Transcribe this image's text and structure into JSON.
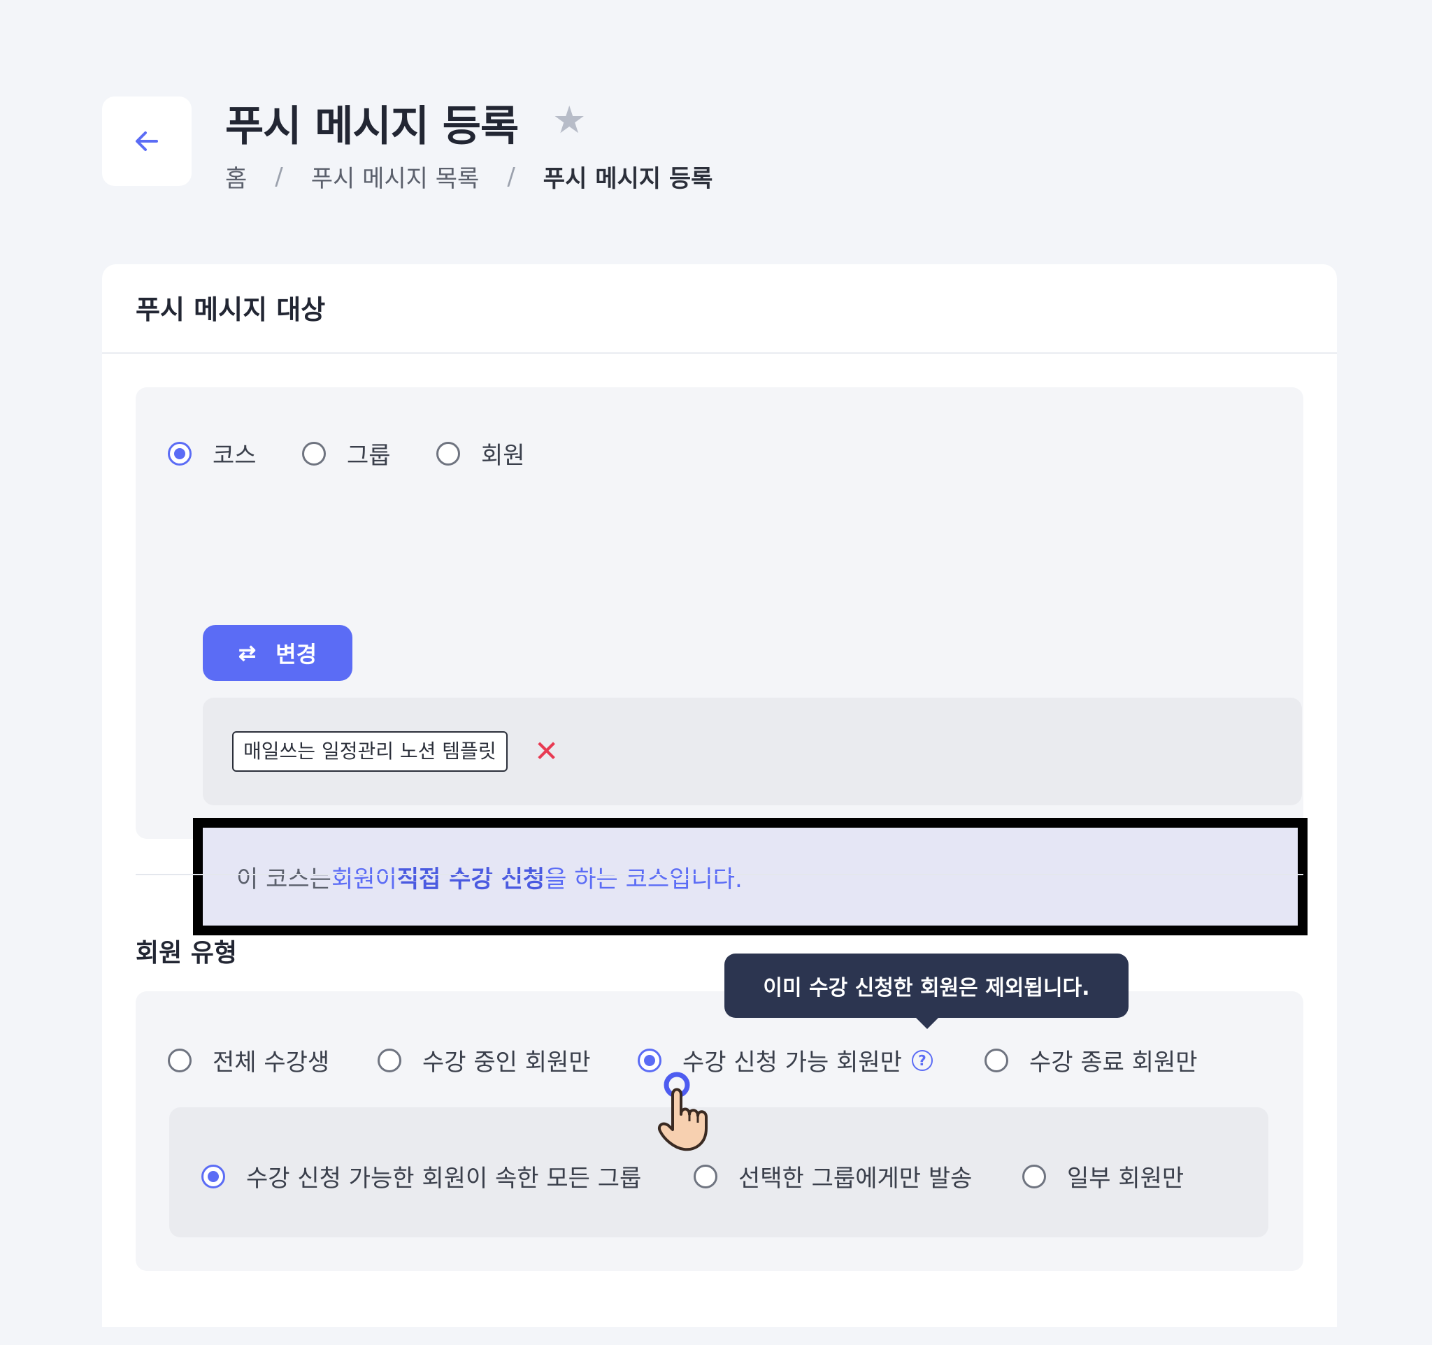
{
  "header": {
    "back_icon": "arrow-left-icon",
    "title": "푸시 메시지 등록",
    "star_icon": "star-icon",
    "breadcrumb": [
      "홈",
      "푸시 메시지 목록",
      "푸시 메시지 등록"
    ],
    "breadcrumb_sep": "/"
  },
  "card": {
    "title": "푸시 메시지 대상",
    "target_options": [
      {
        "label": "코스",
        "selected": true
      },
      {
        "label": "그룹",
        "selected": false
      },
      {
        "label": "회원",
        "selected": false
      }
    ],
    "change_button": {
      "label": "변경",
      "icon": "swap-arrows-icon"
    },
    "selected_chip": "매일쓰는 일정관리 노션 템플릿",
    "remove_icon": "close-icon",
    "info": {
      "p1": "이 코스는 ",
      "p2": "회원이 ",
      "p3": "직접 수강 신청",
      "p4": "을 하는 코스입니다."
    },
    "member_type_label": "회원 유형",
    "member_type_options": [
      {
        "label": "전체 수강생",
        "selected": false
      },
      {
        "label": "수강 중인 회원만",
        "selected": false
      },
      {
        "label": "수강 신청 가능 회원만",
        "selected": true
      },
      {
        "label": "수강 종료 회원만",
        "selected": false
      }
    ],
    "help_icon": "question-circle-icon",
    "help_mark": "?",
    "tooltip": "이미 수강 신청한 회원은 제외됩니다.",
    "group_options": [
      {
        "label": "수강 신청 가능한 회원이 속한 모든 그룹",
        "selected": true
      },
      {
        "label": "선택한 그룹에게만 발송",
        "selected": false
      },
      {
        "label": "일부 회원만",
        "selected": false
      }
    ]
  },
  "colors": {
    "accent": "#5b6cf5",
    "tooltip_bg": "#2c3550",
    "danger": "#e83a52"
  }
}
